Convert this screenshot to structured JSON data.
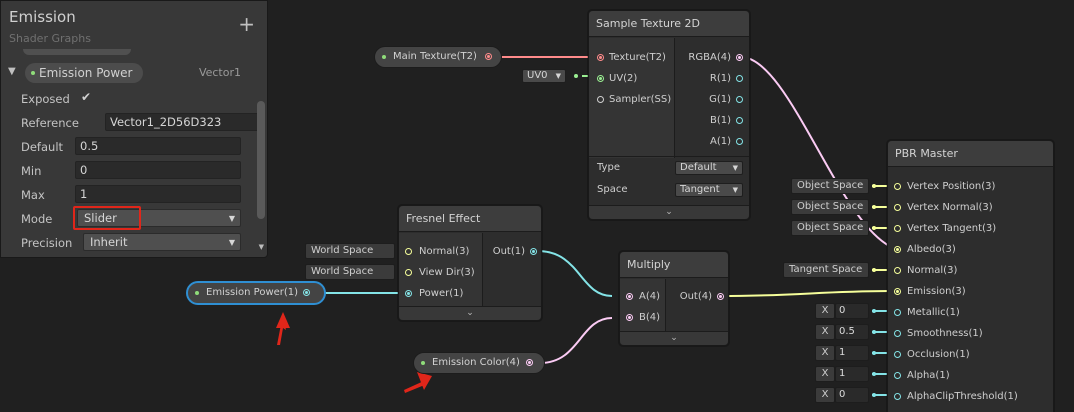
{
  "blackboard": {
    "title": "Emission",
    "subtitle": "Shader Graphs",
    "add_icon": "plus-icon",
    "property": {
      "name": "Emission Power",
      "type": "Vector1",
      "fields": {
        "exposed_label": "Exposed",
        "exposed_checked": true,
        "exposed_mark": "✔",
        "reference_label": "Reference",
        "reference_value": "Vector1_2D56D323",
        "default_label": "Default",
        "default_value": "0.5",
        "min_label": "Min",
        "min_value": "0",
        "max_label": "Max",
        "max_value": "1",
        "mode_label": "Mode",
        "mode_value": "Slider",
        "precision_label": "Precision",
        "precision_value": "Inherit"
      }
    }
  },
  "nodes": {
    "sample_texture": {
      "title": "Sample Texture 2D",
      "inputs": [
        "Texture(T2)",
        "UV(2)",
        "Sampler(SS)"
      ],
      "outputs": [
        "RGBA(4)",
        "R(1)",
        "G(1)",
        "B(1)",
        "A(1)"
      ],
      "type_label": "Type",
      "type_value": "Default",
      "space_label": "Space",
      "space_value": "Tangent",
      "uv_value": "UV0"
    },
    "fresnel": {
      "title": "Fresnel Effect",
      "inputs": [
        "Normal(3)",
        "View Dir(3)",
        "Power(1)"
      ],
      "outputs": [
        "Out(1)"
      ],
      "normal_default": "World Space",
      "viewdir_default": "World Space"
    },
    "multiply": {
      "title": "Multiply",
      "inputs": [
        "A(4)",
        "B(4)"
      ],
      "outputs": [
        "Out(4)"
      ]
    },
    "pbr_master": {
      "title": "PBR Master",
      "inputs": [
        "Vertex Position(3)",
        "Vertex Normal(3)",
        "Vertex Tangent(3)",
        "Albedo(3)",
        "Normal(3)",
        "Emission(3)",
        "Metallic(1)",
        "Smoothness(1)",
        "Occlusion(1)",
        "Alpha(1)",
        "AlphaClipThreshold(1)"
      ],
      "defaults": {
        "vertex_position": "Object Space",
        "vertex_normal": "Object Space",
        "vertex_tangent": "Object Space",
        "normal": "Tangent Space",
        "x_label": "X",
        "metallic": "0",
        "smoothness": "0.5",
        "occlusion": "1",
        "alpha": "1",
        "alpha_clip": "0"
      }
    },
    "main_texture": {
      "label": "Main Texture(T2)"
    },
    "emission_power": {
      "label": "Emission Power(1)"
    },
    "emission_color": {
      "label": "Emission Color(4)"
    }
  },
  "icons": {
    "expand": "chevron-down-icon",
    "collapse": "chevron-down-icon",
    "annotation": "red-arrow"
  },
  "colors": {
    "texture": "#ff8b8b",
    "vector4": "#fbcbf4",
    "vector3": "#f6ff9a",
    "vector2": "#9aef92",
    "vector1": "#84e4e7",
    "highlight": "#e0261a",
    "selection": "#2f8fd3"
  }
}
